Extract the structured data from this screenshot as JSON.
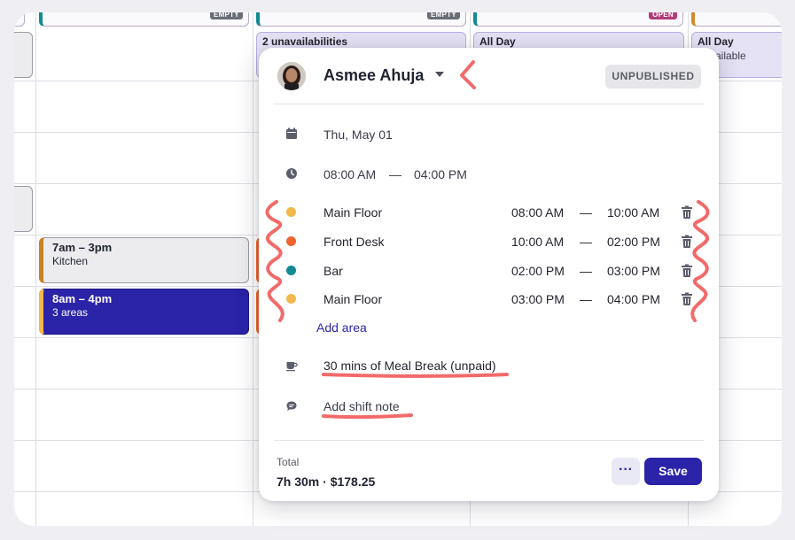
{
  "schedule": {
    "top_badges": [
      "EMPTY",
      "EMPTY",
      "OPEN"
    ],
    "unavailability": [
      {
        "title": "2 unavailabilities",
        "sub": ""
      },
      {
        "title": "All Day",
        "sub": ""
      },
      {
        "title": "All Day",
        "sub": "vailable"
      }
    ],
    "shifts": [
      {
        "time": "7am – 3pm",
        "sub": "Kitchen"
      },
      {
        "time": "8am – 4pm",
        "sub": "3 areas"
      }
    ]
  },
  "popup": {
    "employee_name": "Asmee Ahuja",
    "status": "UNPUBLISHED",
    "date": "Thu, May 01",
    "start_time": "08:00 AM",
    "time_sep": "—",
    "end_time": "04:00 PM",
    "areas": [
      {
        "name": "Main Floor",
        "start": "08:00 AM",
        "sep": "—",
        "end": "10:00 AM",
        "color": "#f2b84b"
      },
      {
        "name": "Front Desk",
        "start": "10:00 AM",
        "sep": "—",
        "end": "02:00 PM",
        "color": "#f0642e"
      },
      {
        "name": "Bar",
        "start": "02:00 PM",
        "sep": "—",
        "end": "03:00 PM",
        "color": "#138a93"
      },
      {
        "name": "Main Floor",
        "start": "03:00 PM",
        "sep": "—",
        "end": "04:00 PM",
        "color": "#f2b84b"
      }
    ],
    "add_area_label": "Add area",
    "meal_break": "30 mins of Meal Break (unpaid)",
    "shift_note_placeholder": "Add shift note",
    "total_label": "Total",
    "total_value": "7h 30m · $178.25",
    "more_label": "···",
    "save_label": "Save"
  },
  "colors": {
    "accent": "#2b23a8",
    "annotation": "#f26a6a"
  }
}
